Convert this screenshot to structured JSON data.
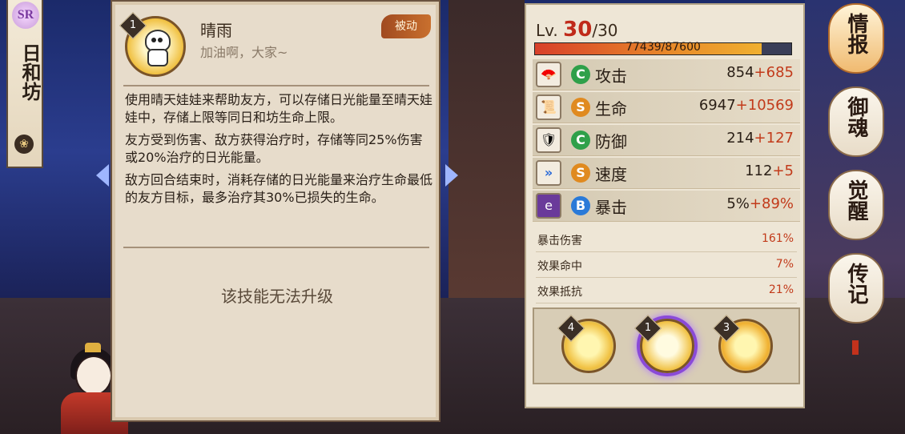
{
  "character": {
    "rarity": "SR",
    "name": "日和坊"
  },
  "skill": {
    "level_badge": "1",
    "name": "晴雨",
    "quote": "加油啊，大家~",
    "type_tag": "被动",
    "description": [
      "使用晴天娃娃来帮助友方，可以存储日光能量至晴天娃娃中，存储上限等同日和坊生命上限。",
      "友方受到伤害、敌方获得治疗时，存储等同25%伤害或20%治疗的日光能量。",
      "敌方回合结束时，消耗存储的日光能量来治疗生命最低的友方目标，最多治疗其30%已损失的生命。"
    ],
    "upgrade_note": "该技能无法升级"
  },
  "stats": {
    "level_prefix": "Lv.",
    "level_current": "30",
    "level_max": "/30",
    "hp_text": "77439/87600",
    "hp_fraction": 0.884,
    "main": [
      {
        "icon": "fan-icon",
        "grade": "C",
        "grade_color": "#2fa04a",
        "label": "攻击",
        "base": "854",
        "bonus": "+685"
      },
      {
        "icon": "scroll-icon",
        "grade": "S",
        "grade_color": "#e08a20",
        "label": "生命",
        "base": "6947",
        "bonus": "+10569"
      },
      {
        "icon": "armor-icon",
        "grade": "C",
        "grade_color": "#2fa04a",
        "label": "防御",
        "base": "214",
        "bonus": "+127"
      },
      {
        "icon": "speed-chevron-icon",
        "grade": "S",
        "grade_color": "#e08a20",
        "label": "速度",
        "base": "112",
        "bonus": "+5"
      },
      {
        "icon": "critical-card-icon",
        "grade": "B",
        "grade_color": "#2a7ad8",
        "label": "暴击",
        "base": "5%",
        "bonus": "+89%"
      }
    ],
    "secondary": [
      {
        "label": "暴击伤害",
        "value": "161%"
      },
      {
        "label": "效果命中",
        "value": "7%"
      },
      {
        "label": "效果抵抗",
        "value": "21%"
      }
    ],
    "skills": [
      {
        "level": "4",
        "icon": "sun-bird-icon"
      },
      {
        "level": "1",
        "icon": "doll-icon"
      },
      {
        "level": "3",
        "icon": "sun-face-icon"
      }
    ]
  },
  "menu": {
    "items": [
      "情报",
      "御魂",
      "觉醒",
      "传记"
    ]
  }
}
